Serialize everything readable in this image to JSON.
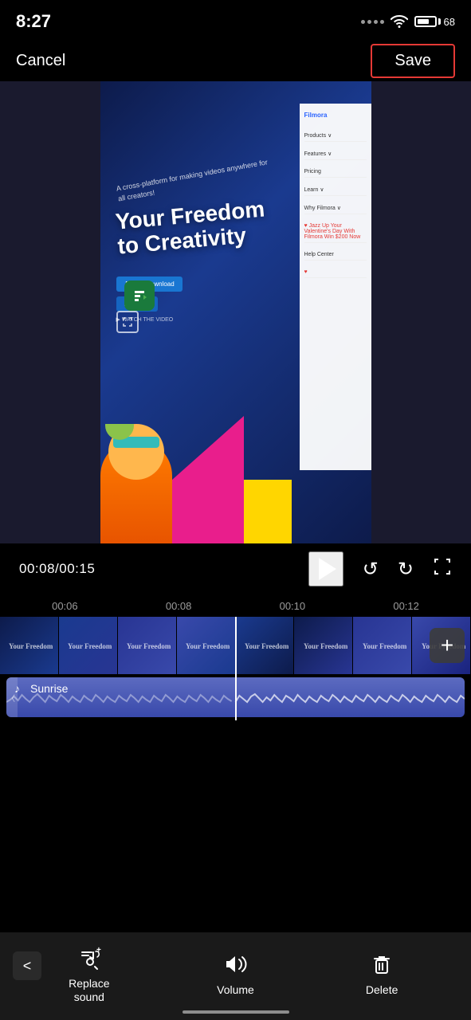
{
  "statusBar": {
    "time": "8:27",
    "battery": "68"
  },
  "header": {
    "cancelLabel": "Cancel",
    "saveLabel": "Save"
  },
  "playback": {
    "currentTime": "00:08",
    "totalTime": "00:15",
    "timeDisplay": "00:08/00:15"
  },
  "timeline": {
    "markers": [
      "00:06",
      "00:08",
      "00:10",
      "00:12"
    ]
  },
  "audioTrack": {
    "musicNoteIcon": "♪",
    "trackName": "Sunrise"
  },
  "toolbar": {
    "items": [
      {
        "id": "replace-sound",
        "label": "Replace\nsound",
        "icon": "replace-sound"
      },
      {
        "id": "volume",
        "label": "Volume",
        "icon": "volume"
      },
      {
        "id": "delete",
        "label": "Delete",
        "icon": "delete"
      }
    ]
  },
  "video": {
    "heroText": "Your Freedom\nto Creativity",
    "subText": "A cross-platform for making videos\nanywhere for all creators!",
    "navItems": [
      "Filmora",
      "Products",
      "Features",
      "Pricing",
      "Learn",
      "Why Filmora",
      "Help Center"
    ]
  },
  "addButtonLabel": "+",
  "icons": {
    "play": "▶",
    "undo": "↺",
    "redo": "↻",
    "expand": "⛶",
    "musicNote": "♩",
    "replaceSoundIcon": "♫+",
    "volumeIcon": "🔊",
    "deleteIcon": "🗑",
    "chevronLeft": "<"
  }
}
